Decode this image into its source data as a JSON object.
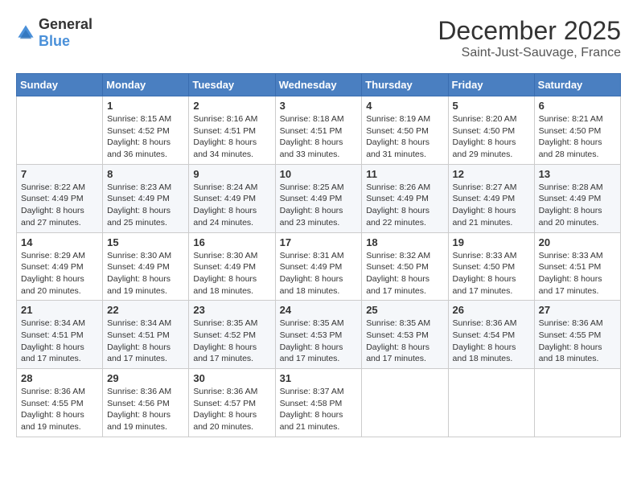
{
  "logo": {
    "general": "General",
    "blue": "Blue"
  },
  "header": {
    "month": "December 2025",
    "location": "Saint-Just-Sauvage, France"
  },
  "days_of_week": [
    "Sunday",
    "Monday",
    "Tuesday",
    "Wednesday",
    "Thursday",
    "Friday",
    "Saturday"
  ],
  "weeks": [
    [
      {
        "day": "",
        "info": ""
      },
      {
        "day": "1",
        "info": "Sunrise: 8:15 AM\nSunset: 4:52 PM\nDaylight: 8 hours\nand 36 minutes."
      },
      {
        "day": "2",
        "info": "Sunrise: 8:16 AM\nSunset: 4:51 PM\nDaylight: 8 hours\nand 34 minutes."
      },
      {
        "day": "3",
        "info": "Sunrise: 8:18 AM\nSunset: 4:51 PM\nDaylight: 8 hours\nand 33 minutes."
      },
      {
        "day": "4",
        "info": "Sunrise: 8:19 AM\nSunset: 4:50 PM\nDaylight: 8 hours\nand 31 minutes."
      },
      {
        "day": "5",
        "info": "Sunrise: 8:20 AM\nSunset: 4:50 PM\nDaylight: 8 hours\nand 29 minutes."
      },
      {
        "day": "6",
        "info": "Sunrise: 8:21 AM\nSunset: 4:50 PM\nDaylight: 8 hours\nand 28 minutes."
      }
    ],
    [
      {
        "day": "7",
        "info": "Sunrise: 8:22 AM\nSunset: 4:49 PM\nDaylight: 8 hours\nand 27 minutes."
      },
      {
        "day": "8",
        "info": "Sunrise: 8:23 AM\nSunset: 4:49 PM\nDaylight: 8 hours\nand 25 minutes."
      },
      {
        "day": "9",
        "info": "Sunrise: 8:24 AM\nSunset: 4:49 PM\nDaylight: 8 hours\nand 24 minutes."
      },
      {
        "day": "10",
        "info": "Sunrise: 8:25 AM\nSunset: 4:49 PM\nDaylight: 8 hours\nand 23 minutes."
      },
      {
        "day": "11",
        "info": "Sunrise: 8:26 AM\nSunset: 4:49 PM\nDaylight: 8 hours\nand 22 minutes."
      },
      {
        "day": "12",
        "info": "Sunrise: 8:27 AM\nSunset: 4:49 PM\nDaylight: 8 hours\nand 21 minutes."
      },
      {
        "day": "13",
        "info": "Sunrise: 8:28 AM\nSunset: 4:49 PM\nDaylight: 8 hours\nand 20 minutes."
      }
    ],
    [
      {
        "day": "14",
        "info": "Sunrise: 8:29 AM\nSunset: 4:49 PM\nDaylight: 8 hours\nand 20 minutes."
      },
      {
        "day": "15",
        "info": "Sunrise: 8:30 AM\nSunset: 4:49 PM\nDaylight: 8 hours\nand 19 minutes."
      },
      {
        "day": "16",
        "info": "Sunrise: 8:30 AM\nSunset: 4:49 PM\nDaylight: 8 hours\nand 18 minutes."
      },
      {
        "day": "17",
        "info": "Sunrise: 8:31 AM\nSunset: 4:49 PM\nDaylight: 8 hours\nand 18 minutes."
      },
      {
        "day": "18",
        "info": "Sunrise: 8:32 AM\nSunset: 4:50 PM\nDaylight: 8 hours\nand 17 minutes."
      },
      {
        "day": "19",
        "info": "Sunrise: 8:33 AM\nSunset: 4:50 PM\nDaylight: 8 hours\nand 17 minutes."
      },
      {
        "day": "20",
        "info": "Sunrise: 8:33 AM\nSunset: 4:51 PM\nDaylight: 8 hours\nand 17 minutes."
      }
    ],
    [
      {
        "day": "21",
        "info": "Sunrise: 8:34 AM\nSunset: 4:51 PM\nDaylight: 8 hours\nand 17 minutes."
      },
      {
        "day": "22",
        "info": "Sunrise: 8:34 AM\nSunset: 4:51 PM\nDaylight: 8 hours\nand 17 minutes."
      },
      {
        "day": "23",
        "info": "Sunrise: 8:35 AM\nSunset: 4:52 PM\nDaylight: 8 hours\nand 17 minutes."
      },
      {
        "day": "24",
        "info": "Sunrise: 8:35 AM\nSunset: 4:53 PM\nDaylight: 8 hours\nand 17 minutes."
      },
      {
        "day": "25",
        "info": "Sunrise: 8:35 AM\nSunset: 4:53 PM\nDaylight: 8 hours\nand 17 minutes."
      },
      {
        "day": "26",
        "info": "Sunrise: 8:36 AM\nSunset: 4:54 PM\nDaylight: 8 hours\nand 18 minutes."
      },
      {
        "day": "27",
        "info": "Sunrise: 8:36 AM\nSunset: 4:55 PM\nDaylight: 8 hours\nand 18 minutes."
      }
    ],
    [
      {
        "day": "28",
        "info": "Sunrise: 8:36 AM\nSunset: 4:55 PM\nDaylight: 8 hours\nand 19 minutes."
      },
      {
        "day": "29",
        "info": "Sunrise: 8:36 AM\nSunset: 4:56 PM\nDaylight: 8 hours\nand 19 minutes."
      },
      {
        "day": "30",
        "info": "Sunrise: 8:36 AM\nSunset: 4:57 PM\nDaylight: 8 hours\nand 20 minutes."
      },
      {
        "day": "31",
        "info": "Sunrise: 8:37 AM\nSunset: 4:58 PM\nDaylight: 8 hours\nand 21 minutes."
      },
      {
        "day": "",
        "info": ""
      },
      {
        "day": "",
        "info": ""
      },
      {
        "day": "",
        "info": ""
      }
    ]
  ]
}
